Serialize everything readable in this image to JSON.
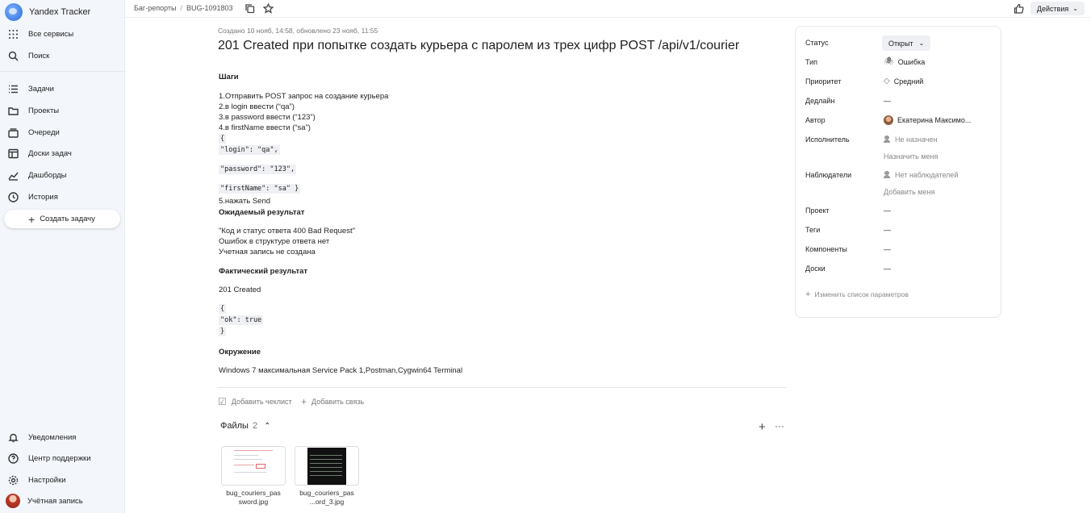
{
  "app": {
    "name": "Yandex Tracker"
  },
  "sidebar": {
    "items": [
      {
        "label": "Все сервисы",
        "icon": "grid-icon"
      },
      {
        "label": "Поиск",
        "icon": "search-icon"
      },
      {
        "label": "Задачи",
        "icon": "tasks-icon"
      },
      {
        "label": "Проекты",
        "icon": "folder-icon"
      },
      {
        "label": "Очереди",
        "icon": "queue-icon"
      },
      {
        "label": "Доски задач",
        "icon": "board-icon"
      },
      {
        "label": "Дашборды",
        "icon": "chart-icon"
      },
      {
        "label": "История",
        "icon": "clock-icon"
      }
    ],
    "create_label": "Создать задачу",
    "bottom_items": [
      {
        "label": "Уведомления",
        "icon": "bell-icon"
      },
      {
        "label": "Центр поддержки",
        "icon": "help-icon"
      },
      {
        "label": "Настройки",
        "icon": "gear-icon"
      },
      {
        "label": "Учётная запись",
        "icon": "avatar"
      }
    ]
  },
  "topbar": {
    "breadcrumb_queue": "Баг-репорты",
    "breadcrumb_issue": "BUG-1091803",
    "actions_label": "Действия"
  },
  "issue": {
    "meta": "Создано 10 нояб, 14:58, обновлено 23 нояб, 11:55",
    "title": "201 Created при попытке создать курьера с паролем из трех цифр POST /api/v1/courier",
    "steps_heading": "Шаги",
    "steps": [
      "1.Отправить POST запрос на создание курьера",
      "2.в login ввести (“qa”)",
      "3.в password ввести (“123”)",
      "4.в firstName ввести (“sa”)"
    ],
    "code_open": "{",
    "code_login": "\"login\": \"qa\",",
    "code_password": "\"password\": \"123\",",
    "code_firstname": "\"firstName\": \"sa\" }",
    "step5": "5.нажать Send",
    "expected_heading": "Ожидаемый результат",
    "expected": [
      "\"Код и статус ответа 400 Bad Request\"",
      "Ошибок в структуре ответа нет",
      "Учетная запись не создана"
    ],
    "actual_heading": "Фактический результат",
    "actual": "201 Created",
    "actual_code_open": "{",
    "actual_code_ok": "\"ok\": true",
    "actual_code_close": "}",
    "env_heading": "Окружение",
    "env": "Windows 7 максимальная Service Pack 1,Postman,Cygwin64 Terminal",
    "add_checklist": "Добавить чеклист",
    "add_link": "Добавить связь",
    "files_label": "Файлы",
    "files_count": "2",
    "files": [
      {
        "name_line1": "bug_couriers_pas",
        "name_line2": "sword.jpg"
      },
      {
        "name_line1": "bug_couriers_pas",
        "name_line2": "...ord_3.jpg"
      }
    ]
  },
  "params": {
    "status_label": "Статус",
    "status_value": "Открыт",
    "type_label": "Тип",
    "type_value": "Ошибка",
    "priority_label": "Приоритет",
    "priority_value": "Средний",
    "deadline_label": "Дедлайн",
    "deadline_value": "—",
    "author_label": "Автор",
    "author_value": "Екатерина Максимо...",
    "assignee_label": "Исполнитель",
    "assignee_value": "Не назначен",
    "assign_me": "Назначить меня",
    "watchers_label": "Наблюдатели",
    "watchers_value": "Нет наблюдателей",
    "add_me": "Добавить меня",
    "project_label": "Проект",
    "project_value": "—",
    "tags_label": "Теги",
    "tags_value": "—",
    "components_label": "Компоненты",
    "components_value": "—",
    "boards_label": "Доски",
    "boards_value": "—",
    "edit_params": "Изменить список параметров"
  }
}
